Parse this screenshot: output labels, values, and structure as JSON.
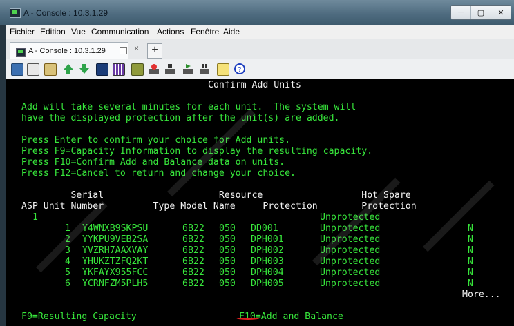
{
  "window": {
    "title": "A - Console : 10.3.1.29",
    "controls": [
      "─",
      "▢",
      "✕"
    ]
  },
  "menu": [
    "Fichier",
    "Edition",
    "Vue",
    "Communication",
    "Actions",
    "Fenêtre",
    "Aide"
  ],
  "tab": {
    "label": "A - Console : 10.3.1.29",
    "close": "×",
    "add": "+"
  },
  "toolbar": [
    "copy-icon",
    "paste-icon",
    "clipboard-icon",
    "upload-icon",
    "download-icon",
    "display-icon",
    "grid-icon",
    "macro-icon",
    "record-icon",
    "stop-icon",
    "play-icon",
    "pause-icon",
    "notes-icon",
    "help-icon"
  ],
  "terminal": {
    "title": "Confirm Add Units",
    "intro": [
      "Add will take several minutes for each unit.  The system will",
      "have the displayed protection after the unit(s) are added."
    ],
    "instructions": [
      "Press Enter to confirm your choice for Add units.",
      "Press F9=Capacity Information to display the resulting capacity.",
      "Press F10=Confirm Add and Balance data on units.",
      "Press F12=Cancel to return and change your choice."
    ],
    "headers": {
      "line1": "         Serial                     Resource                  Hot Spare",
      "line2": "ASP Unit Number         Type Model Name     Protection        Protection"
    },
    "asp": "1",
    "rows": [
      {
        "unit": "1",
        "serial": "Y4WNXB9SKPSU",
        "type": "6B22",
        "model": "050",
        "resource": "DD001",
        "protection": "Unprotected",
        "hot_spare": "N"
      },
      {
        "unit": "2",
        "serial": "YYKPU9VEB2SA",
        "type": "6B22",
        "model": "050",
        "resource": "DPH001",
        "protection": "Unprotected",
        "hot_spare": "N"
      },
      {
        "unit": "3",
        "serial": "YVZRH7AAXVAY",
        "type": "6B22",
        "model": "050",
        "resource": "DPH002",
        "protection": "Unprotected",
        "hot_spare": "N"
      },
      {
        "unit": "4",
        "serial": "YHUKZTZFQ2KT",
        "type": "6B22",
        "model": "050",
        "resource": "DPH003",
        "protection": "Unprotected",
        "hot_spare": "N"
      },
      {
        "unit": "5",
        "serial": "YKFAYX955FCC",
        "type": "6B22",
        "model": "050",
        "resource": "DPH004",
        "protection": "Unprotected",
        "hot_spare": "N"
      },
      {
        "unit": "6",
        "serial": "YCRNFZM5PLH5",
        "type": "6B22",
        "model": "050",
        "resource": "DPH005",
        "protection": "Unprotected",
        "hot_spare": "N"
      }
    ],
    "more": "More...",
    "fkeys": {
      "f9": "F9=Resulting Capacity",
      "f10": "F10=Add and Balance"
    }
  },
  "colors": {
    "terminal_green": "#37e53b",
    "terminal_white": "#f1f1f1",
    "terminal_bg": "#000000",
    "f10_mark": "#e02020"
  }
}
